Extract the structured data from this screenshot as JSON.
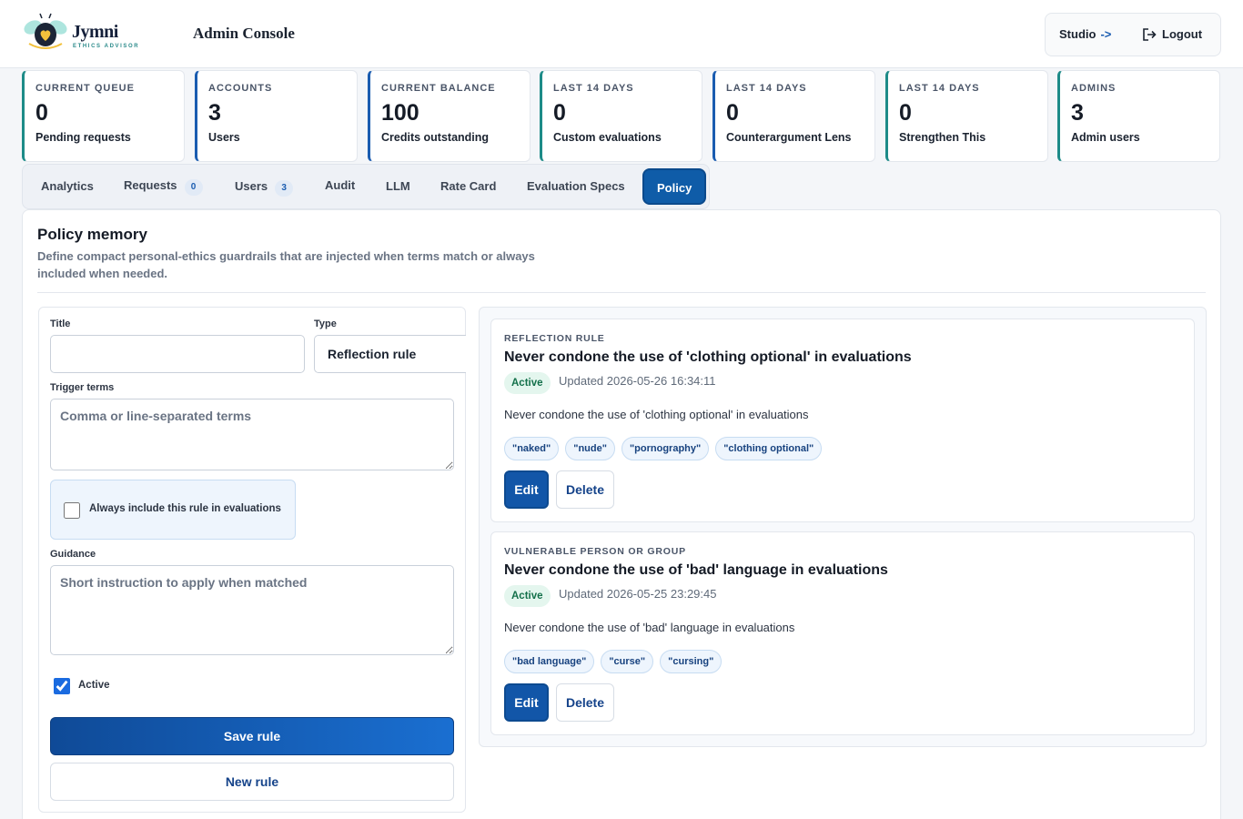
{
  "app": {
    "name": "Jymni",
    "tagline": "ETHICS ADVISOR",
    "console_title": "Admin Console"
  },
  "header": {
    "studio_label": "Studio",
    "studio_arrow": "->",
    "logout_label": "Logout"
  },
  "stats": [
    {
      "eyebrow": "CURRENT QUEUE",
      "value": "0",
      "label": "Pending requests"
    },
    {
      "eyebrow": "ACCOUNTS",
      "value": "3",
      "label": "Users"
    },
    {
      "eyebrow": "CURRENT BALANCE",
      "value": "100",
      "label": "Credits outstanding"
    },
    {
      "eyebrow": "LAST 14 DAYS",
      "value": "0",
      "label": "Custom evaluations"
    },
    {
      "eyebrow": "LAST 14 DAYS",
      "value": "0",
      "label": "Counterargument Lens"
    },
    {
      "eyebrow": "LAST 14 DAYS",
      "value": "0",
      "label": "Strengthen This"
    },
    {
      "eyebrow": "ADMINS",
      "value": "3",
      "label": "Admin users"
    }
  ],
  "tabs": [
    {
      "label": "Analytics"
    },
    {
      "label": "Requests",
      "count": "0"
    },
    {
      "label": "Users",
      "count": "3"
    },
    {
      "label": "Audit"
    },
    {
      "label": "LLM"
    },
    {
      "label": "Rate Card"
    },
    {
      "label": "Evaluation Specs"
    },
    {
      "label": "Policy",
      "active": true
    }
  ],
  "policy": {
    "title": "Policy memory",
    "description": "Define compact personal-ethics guardrails that are injected when terms match or always included when needed."
  },
  "form": {
    "title_label": "Title",
    "title_value": "",
    "type_label": "Type",
    "type_value": "Reflection rule",
    "trigger_label": "Trigger terms",
    "trigger_placeholder": "Comma or line-separated terms",
    "always_label": "Always include this rule in evaluations",
    "always_checked": false,
    "guidance_label": "Guidance",
    "guidance_placeholder": "Short instruction to apply when matched",
    "active_label": "Active",
    "active_checked": true,
    "save_label": "Save rule",
    "new_label": "New rule"
  },
  "rules": [
    {
      "kind": "REFLECTION RULE",
      "title": "Never condone the use of 'clothing optional' in evaluations",
      "status": "Active",
      "updated": "Updated 2026-05-26 16:34:11",
      "body": "Never condone the use of 'clothing optional' in evaluations",
      "tags": [
        "\"naked\"",
        "\"nude\"",
        "\"pornography\"",
        "\"clothing optional\""
      ],
      "edit_label": "Edit",
      "delete_label": "Delete"
    },
    {
      "kind": "VULNERABLE PERSON OR GROUP",
      "title": "Never condone the use of 'bad' language in evaluations",
      "status": "Active",
      "updated": "Updated 2026-05-25 23:29:45",
      "body": "Never condone the use of 'bad' language in evaluations",
      "tags": [
        "\"bad language\"",
        "\"curse\"",
        "\"cursing\""
      ],
      "edit_label": "Edit",
      "delete_label": "Delete"
    }
  ],
  "colors": {
    "accent_teal": "#1d8b88",
    "accent_blue": "#1a5cb0",
    "primary_button": "#0f5ca8",
    "active_badge_bg": "#e4f6ee",
    "active_badge_text": "#13704a"
  },
  "icons": {
    "logo": "bee-heart-logo-icon",
    "logout": "logout-icon"
  }
}
